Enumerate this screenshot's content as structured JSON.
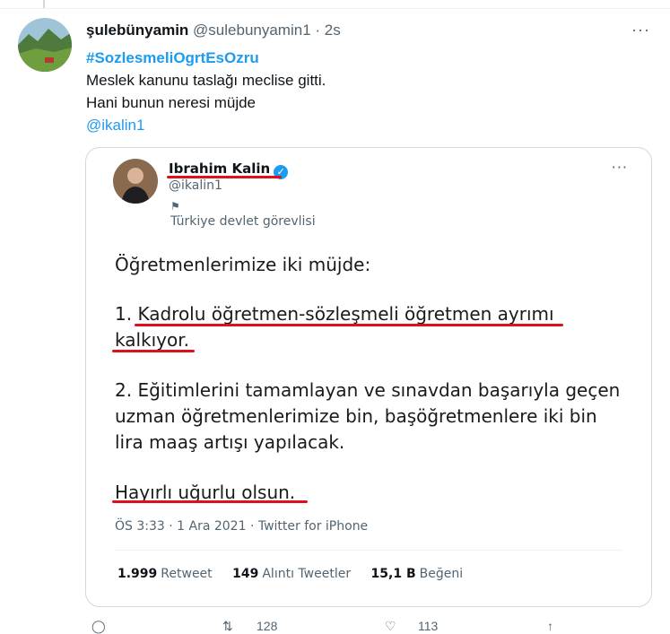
{
  "tweet": {
    "display_name": "şulebünyamin",
    "handle_meta": "@sulebunyamin1 · 2s",
    "hashtag": "#SozlesmeliOgrtEsOzru",
    "line1": "Meslek kanunu taslağı meclise gitti.",
    "line2": "Hani bunun neresi müjde",
    "mention": "@ikalin1",
    "more_icon": "···"
  },
  "quoted": {
    "name": "Ibrahim Kalin",
    "verified_icon": "✓",
    "handle": "@ikalin1",
    "flag_icon": "⚑",
    "label": "Türkiye devlet görevlisi",
    "more_icon": "···",
    "paragraphs": [
      "Öğretmenlerimize iki müjde:",
      "1. Kadrolu öğretmen-sözleşmeli öğretmen ayrımı",
      "kalkıyor.",
      "2. Eğitimlerini tamamlayan ve sınavdan başarıyla geçen",
      "uzman öğretmenlerimize bin, başöğretmenlere iki bin",
      "lira maaş artışı yapılacak.",
      "Hayırlı uğurlu olsun."
    ],
    "timestamp": "ÖS 3:33 · 1 Ara 2021 · Twitter for iPhone",
    "stats": [
      {
        "count": "1.999",
        "label": "Retweet"
      },
      {
        "count": "149",
        "label": "Alıntı Tweetler"
      },
      {
        "count": "15,1 B",
        "label": "Beğeni"
      }
    ]
  },
  "actions": {
    "reply_icon": "◯",
    "retweet_icon": "⇅",
    "retweet_count": "128",
    "like_icon": "♡",
    "like_count": "113",
    "share_icon": "↑"
  }
}
